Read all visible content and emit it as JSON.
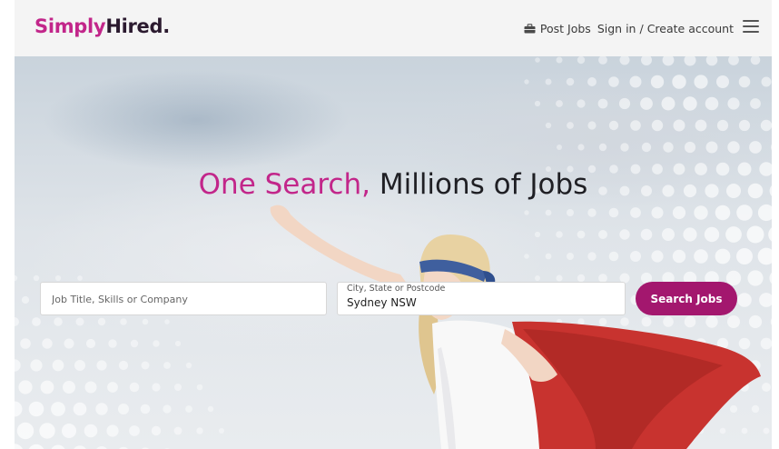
{
  "header": {
    "logo_primary": "Simply",
    "logo_secondary": "Hired.",
    "post_jobs_label": "Post Jobs",
    "sign_in_label": "Sign in",
    "separator": "/",
    "create_account_label": "Create account",
    "post_jobs_icon": "briefcase-icon",
    "menu_icon": "menu-icon"
  },
  "hero": {
    "headline_accent": "One Search,",
    "headline_rest": "Millions of Jobs"
  },
  "search": {
    "what_placeholder": "Job Title, Skills or Company",
    "what_value": "",
    "where_label": "City, State or Postcode",
    "where_value": "Sydney NSW",
    "button_label": "Search Jobs"
  },
  "colors": {
    "brand_pink": "#c2268a",
    "button_purple": "#a3176e",
    "logo_dark": "#2b1a2f",
    "header_bg": "#f4f4f4"
  }
}
